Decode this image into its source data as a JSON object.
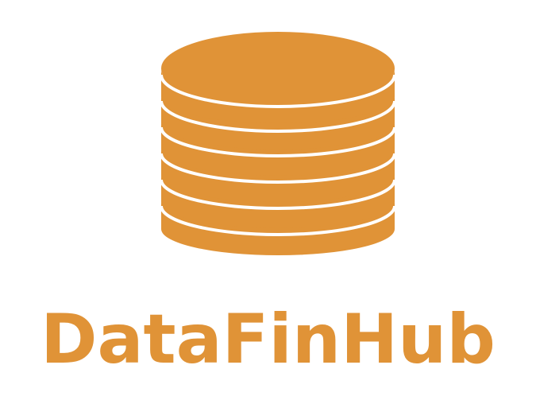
{
  "brand": {
    "name": "DataFinHub",
    "color": "#e09337",
    "background": "#ffffff",
    "icon": "database-stack-icon"
  }
}
